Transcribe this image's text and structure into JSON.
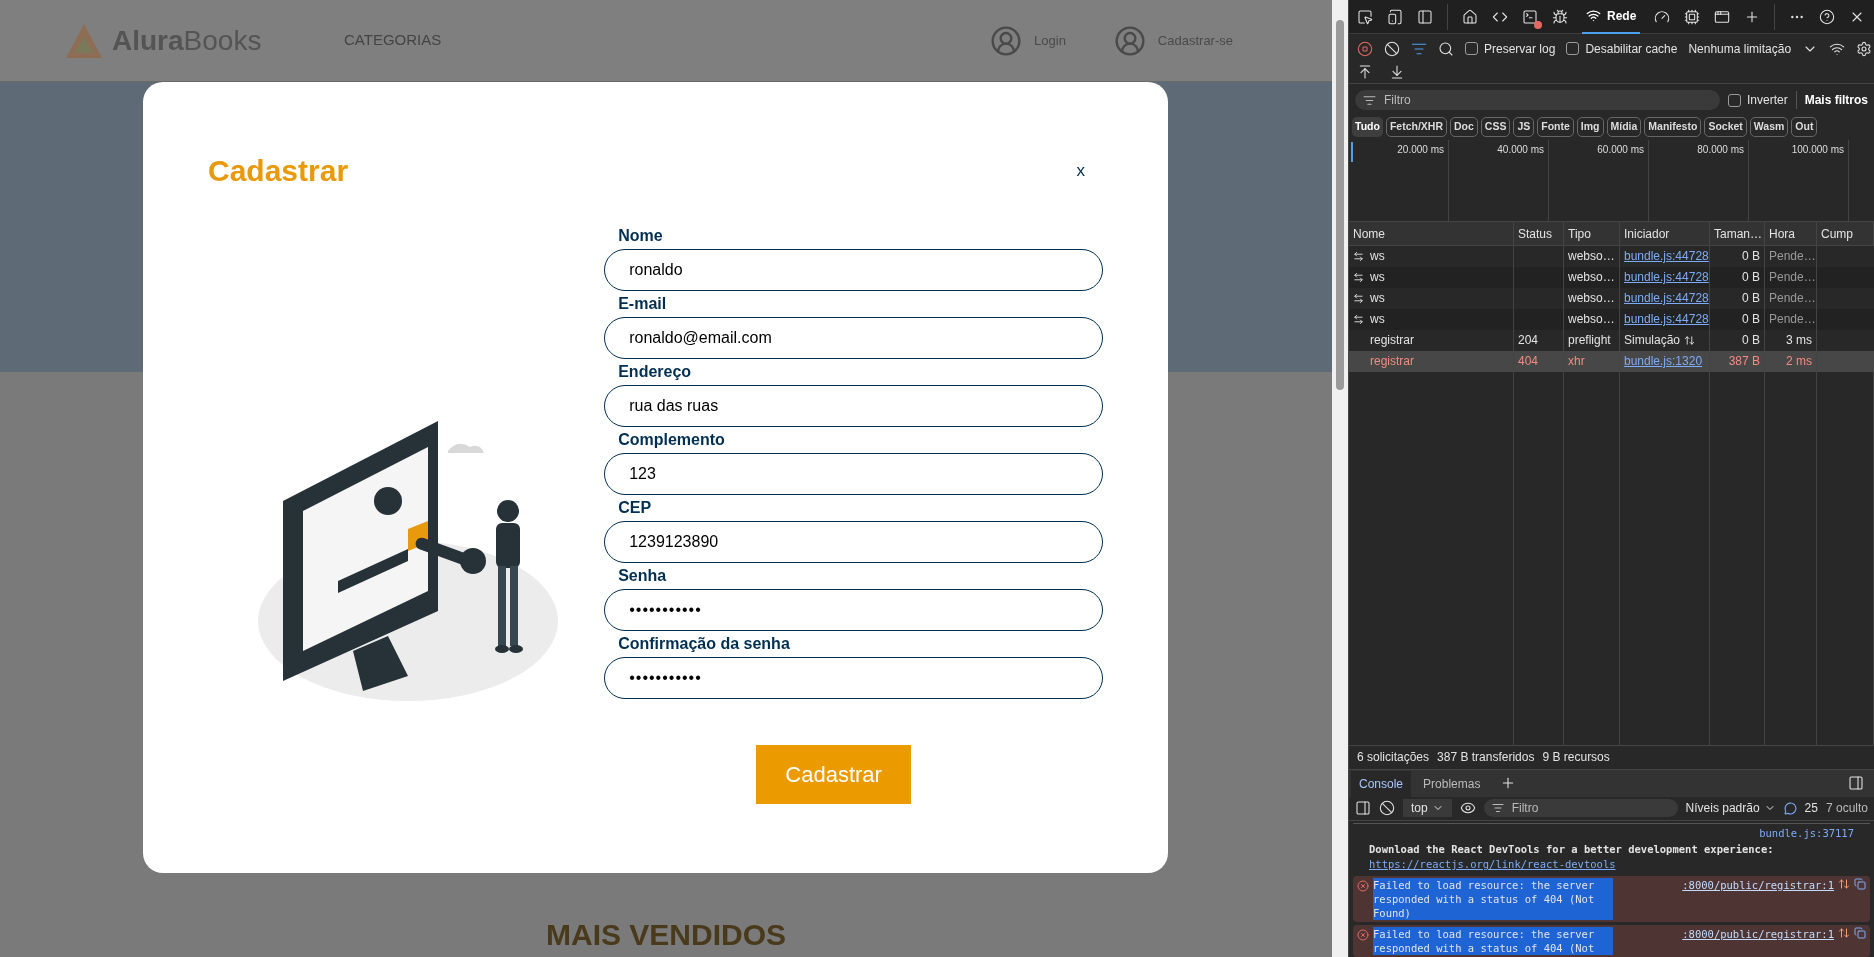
{
  "page": {
    "header": {
      "logo_bold": "Alura",
      "logo_light": "Books",
      "nav": [
        "CATEGORIAS"
      ],
      "actions": [
        {
          "label": "Login"
        },
        {
          "label": "Cadastrar-se"
        }
      ]
    },
    "section_title": "MAIS VENDIDOS"
  },
  "modal": {
    "title": "Cadastrar",
    "close": "x",
    "fields": [
      {
        "label": "Nome",
        "value": "ronaldo",
        "kind": "text"
      },
      {
        "label": "E-mail",
        "value": "ronaldo@email.com",
        "kind": "text"
      },
      {
        "label": "Endereço",
        "value": "rua das ruas",
        "kind": "text"
      },
      {
        "label": "Complemento",
        "value": "123",
        "kind": "text"
      },
      {
        "label": "CEP",
        "value": "1239123890",
        "kind": "text"
      },
      {
        "label": "Senha",
        "value": "•••••••••••",
        "kind": "password"
      },
      {
        "label": "Confirmação da senha",
        "value": "•••••••••••",
        "kind": "password"
      }
    ],
    "submit": "Cadastrar"
  },
  "devtools": {
    "tabs": [
      {
        "label": "Rede",
        "selected": true
      }
    ],
    "toolbar": {
      "checkboxes": [
        {
          "label": "Preservar log",
          "checked": false
        },
        {
          "label": "Desabilitar cache",
          "checked": false
        }
      ],
      "throttling": "Nenhuma limitação"
    },
    "filter": {
      "placeholder": "Filtro",
      "invert": {
        "label": "Inverter",
        "checked": false
      },
      "more_filters": "Mais filtros"
    },
    "type_filters": [
      {
        "label": "Tudo",
        "selected": true
      },
      {
        "label": "Fetch/XHR",
        "selected": false
      },
      {
        "label": "Doc",
        "selected": false
      },
      {
        "label": "CSS",
        "selected": false
      },
      {
        "label": "JS",
        "selected": false
      },
      {
        "label": "Fonte",
        "selected": false
      },
      {
        "label": "Img",
        "selected": false
      },
      {
        "label": "Mídia",
        "selected": false
      },
      {
        "label": "Manifesto",
        "selected": false
      },
      {
        "label": "Socket",
        "selected": false
      },
      {
        "label": "Wasm",
        "selected": false
      },
      {
        "label": "Out",
        "selected": false
      }
    ],
    "timeline_ticks": [
      "20.000 ms",
      "40.000 ms",
      "60.000 ms",
      "80.000 ms",
      "100.000 ms"
    ],
    "table": {
      "columns": [
        "Nome",
        "Status",
        "Tipo",
        "Iniciador",
        "Taman…",
        "Hora",
        "Cump"
      ],
      "rows": [
        {
          "kind": "websocket",
          "name": "ws",
          "status": "",
          "type": "webso…",
          "initiator": {
            "kind": "link",
            "label": "bundle.js:44728"
          },
          "size": "0 B",
          "time": "Pende…",
          "error": false,
          "selected": false
        },
        {
          "kind": "websocket",
          "name": "ws",
          "status": "",
          "type": "webso…",
          "initiator": {
            "kind": "link",
            "label": "bundle.js:44728"
          },
          "size": "0 B",
          "time": "Pende…",
          "error": false,
          "selected": false
        },
        {
          "kind": "websocket",
          "name": "ws",
          "status": "",
          "type": "webso…",
          "initiator": {
            "kind": "link",
            "label": "bundle.js:44728"
          },
          "size": "0 B",
          "time": "Pende…",
          "error": false,
          "selected": false
        },
        {
          "kind": "websocket",
          "name": "ws",
          "status": "",
          "type": "webso…",
          "initiator": {
            "kind": "link",
            "label": "bundle.js:44728"
          },
          "size": "0 B",
          "time": "Pende…",
          "error": false,
          "selected": false
        },
        {
          "kind": "request",
          "name": "registrar",
          "status": "204",
          "type": "preflight",
          "initiator": {
            "kind": "preflight",
            "label": "Simulação"
          },
          "size": "0 B",
          "time": "3 ms",
          "error": false,
          "selected": false
        },
        {
          "kind": "request",
          "name": "registrar",
          "status": "404",
          "type": "xhr",
          "initiator": {
            "kind": "link",
            "label": "bundle.js:1320"
          },
          "size": "387 B",
          "time": "2 ms",
          "error": true,
          "selected": true
        }
      ]
    },
    "summary": [
      "6 solicitações",
      "387 B transferidos",
      "9 B recursos"
    ],
    "drawer_tabs": [
      {
        "label": "Console",
        "selected": true
      },
      {
        "label": "Problemas",
        "selected": false
      }
    ],
    "console": {
      "context": "top",
      "filter_placeholder": "Filtro",
      "levels": "Níveis padrão",
      "message_count": "25",
      "hidden": "7 oculto",
      "messages": [
        {
          "kind": "log",
          "source": "bundle.js:37117",
          "text": "Download the React DevTools for a better development experience:",
          "link": "https://reactjs.org/link/react-devtools"
        },
        {
          "kind": "error",
          "text": "Failed to load resource: the server responded with a status of 404 (Not Found)",
          "source": ":8000/public/registrar:1",
          "highlighted": true
        },
        {
          "kind": "error",
          "text": "Failed to load resource: the server responded with a status of 404 (Not",
          "source": ":8000/public/registrar:1",
          "highlighted": true
        }
      ]
    }
  }
}
